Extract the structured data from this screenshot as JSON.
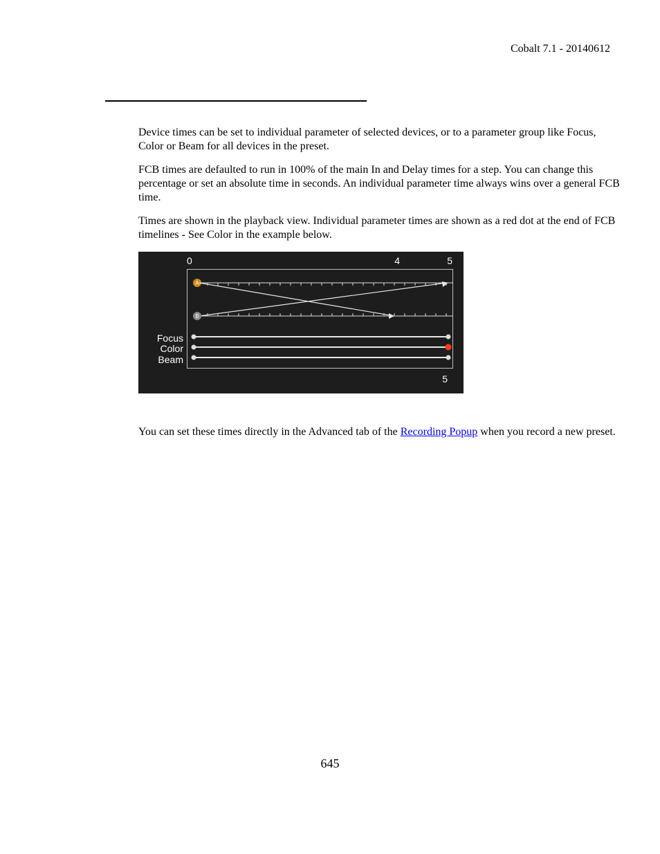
{
  "header": {
    "text": "Cobalt 7.1 - 20140612"
  },
  "paragraphs": {
    "p1": "Device times can be set to individual parameter of selected devices, or to a parameter group like Focus, Color or Beam for all devices in the preset.",
    "p2": "FCB times are defaulted to run in 100% of the main In and Delay times for a step. You can change this percentage or set an absolute time in seconds. An individual parameter time always wins over a general FCB time.",
    "p3": "Times are shown in the playback view. Individual parameter times are shown as a red dot at the end of FCB timelines - See Color in the example below.",
    "p4a": "You can set these times directly in the Advanced tab of the ",
    "p4link": "Recording Popup",
    "p4b": " when you record a new preset."
  },
  "diagram": {
    "axisTop": {
      "n0": "0",
      "n4": "4",
      "n5": "5"
    },
    "markers": {
      "A": "A",
      "B": "B"
    },
    "labels": {
      "focus": "Focus",
      "color": "Color",
      "beam": "Beam"
    },
    "bottom": "5"
  },
  "pageNumber": "645"
}
